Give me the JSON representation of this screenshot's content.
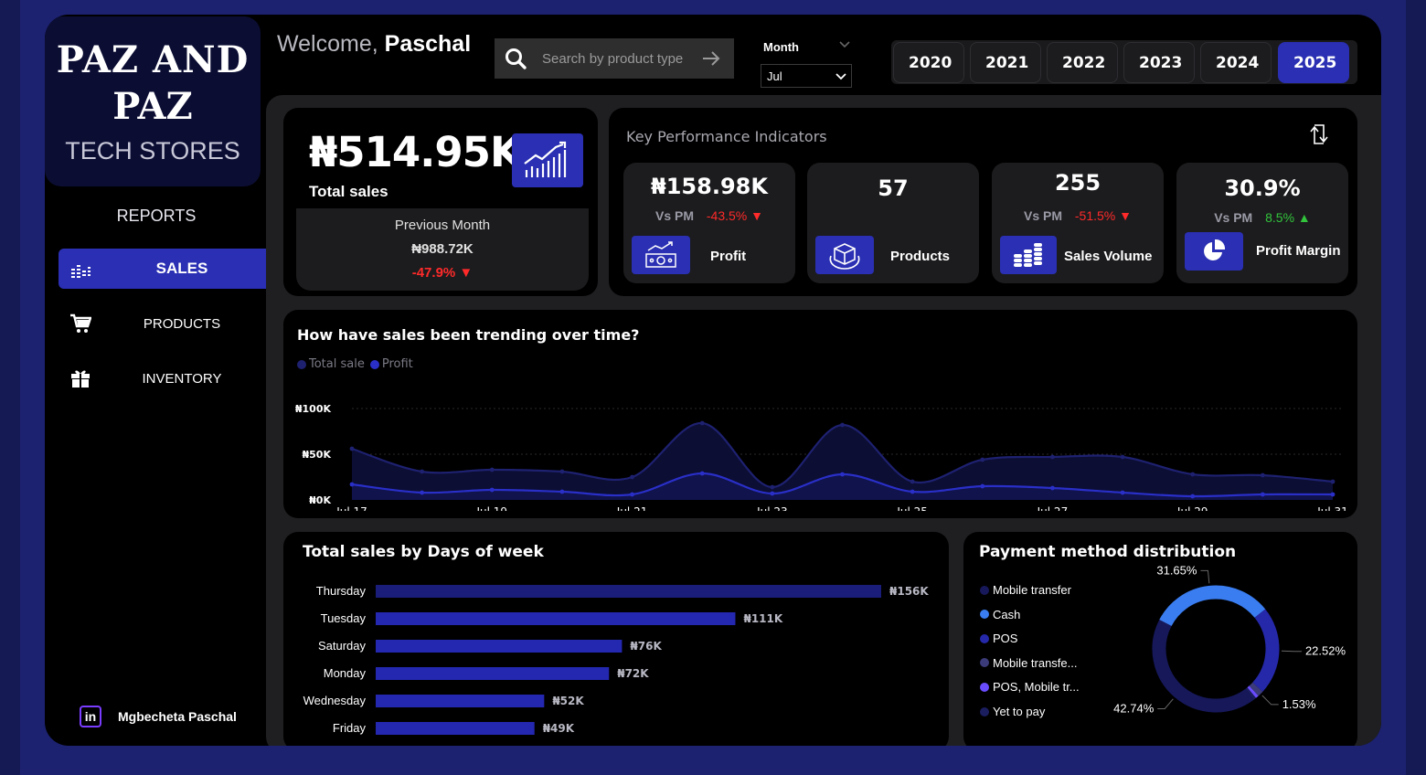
{
  "brand": {
    "line1": "PAZ AND",
    "line2": "PAZ",
    "line3": "TECH STORES"
  },
  "sidebar": {
    "reports_label": "REPORTS",
    "items": [
      {
        "label": "SALES",
        "icon": "bar-chart-icon",
        "active": true
      },
      {
        "label": "PRODUCTS",
        "icon": "cart-icon",
        "active": false
      },
      {
        "label": "INVENTORY",
        "icon": "gift-box-icon",
        "active": false
      }
    ],
    "author": {
      "icon": "linkedin-icon",
      "icon_text": "in",
      "name": "Mgbecheta Paschal"
    }
  },
  "header": {
    "welcome_prefix": "Welcome,",
    "welcome_name": "Paschal",
    "search": {
      "placeholder": "Search by product type"
    },
    "month": {
      "label": "Month",
      "selected": "Jul"
    },
    "years": [
      "2020",
      "2021",
      "2022",
      "2023",
      "2024",
      "2025"
    ],
    "active_year": "2025"
  },
  "total_sales": {
    "value": "₦514.95K",
    "label": "Total sales",
    "previous": {
      "title": "Previous Month",
      "value": "₦988.72K",
      "change": "-47.9%",
      "direction": "down"
    }
  },
  "kpis": {
    "title": "Key Performance Indicators",
    "vs_label": "Vs PM",
    "items": [
      {
        "value": "₦158.98K",
        "change": "-43.5%",
        "direction": "down",
        "label": "Profit",
        "icon": "cash-chart-icon"
      },
      {
        "value": "57",
        "change": "",
        "direction": "",
        "label": "Products",
        "icon": "package-icon"
      },
      {
        "value": "255",
        "change": "-51.5%",
        "direction": "down",
        "label": "Sales Volume",
        "icon": "coins-stack-icon"
      },
      {
        "value": "30.9%",
        "change": "8.5%",
        "direction": "up",
        "label": "Profit Margin",
        "icon": "pie-chart-icon"
      }
    ]
  },
  "colors": {
    "accent": "#2a2fb3",
    "negative": "#ff2a2a",
    "positive": "#32c43c",
    "total_sale_series": "#1e2170",
    "profit_series": "#2a2fc8"
  },
  "trend": {
    "title": "How have sales been trending over time?",
    "legend": [
      {
        "name": "Total sale",
        "color": "#1e2170"
      },
      {
        "name": "Profit",
        "color": "#2a2fc8"
      }
    ]
  },
  "dow": {
    "title": "Total sales by Days of week"
  },
  "payment": {
    "title": "Payment method distribution"
  },
  "chart_data": [
    {
      "type": "area",
      "title": "How have sales been trending over time?",
      "x": [
        "Jul 17",
        "Jul 18",
        "Jul 19",
        "Jul 20",
        "Jul 21",
        "Jul 22",
        "Jul 23",
        "Jul 24",
        "Jul 25",
        "Jul 26",
        "Jul 27",
        "Jul 28",
        "Jul 29",
        "Jul 30",
        "Jul 31"
      ],
      "x_tick_labels": [
        "Jul 17",
        "Jul 19",
        "Jul 21",
        "Jul 23",
        "Jul 25",
        "Jul 27",
        "Jul 29",
        "Jul 31"
      ],
      "y_tick_labels": [
        "₦100K",
        "₦50K",
        "₦0K"
      ],
      "ylim": [
        0,
        100000
      ],
      "grid": true,
      "legend_position": "top-left",
      "series": [
        {
          "name": "Total sale",
          "values": [
            56000,
            31000,
            33000,
            31000,
            25000,
            84000,
            14000,
            82000,
            20000,
            44000,
            47000,
            47000,
            28000,
            27000,
            20000
          ]
        },
        {
          "name": "Profit",
          "values": [
            17000,
            8000,
            11000,
            9000,
            6000,
            29000,
            7000,
            28000,
            9000,
            15000,
            13000,
            8000,
            4000,
            6000,
            6000
          ]
        }
      ]
    },
    {
      "type": "bar",
      "title": "Total sales by Days of week",
      "categories": [
        "Thursday",
        "Tuesday",
        "Saturday",
        "Monday",
        "Wednesday",
        "Friday"
      ],
      "values": [
        156000,
        111000,
        76000,
        72000,
        52000,
        49000
      ],
      "value_labels": [
        "₦156K",
        "₦111K",
        "₦76K",
        "₦72K",
        "₦52K",
        "₦49K"
      ]
    },
    {
      "type": "pie",
      "title": "Payment method distribution",
      "labels": [
        "Mobile transfer",
        "Cash",
        "POS",
        "Mobile transfe...",
        "POS, Mobile tr...",
        "Yet to  pay"
      ],
      "colors": [
        "#16185a",
        "#3a7df0",
        "#2528a8",
        "#3b3b7a",
        "#6a4cff",
        "#1a1d5e"
      ],
      "slice_values": [
        42.74,
        31.65,
        22.52,
        1.53,
        0.8,
        0.76
      ],
      "slice_labels": [
        "42.74%",
        "31.65%",
        "22.52%",
        "1.53%"
      ]
    }
  ]
}
